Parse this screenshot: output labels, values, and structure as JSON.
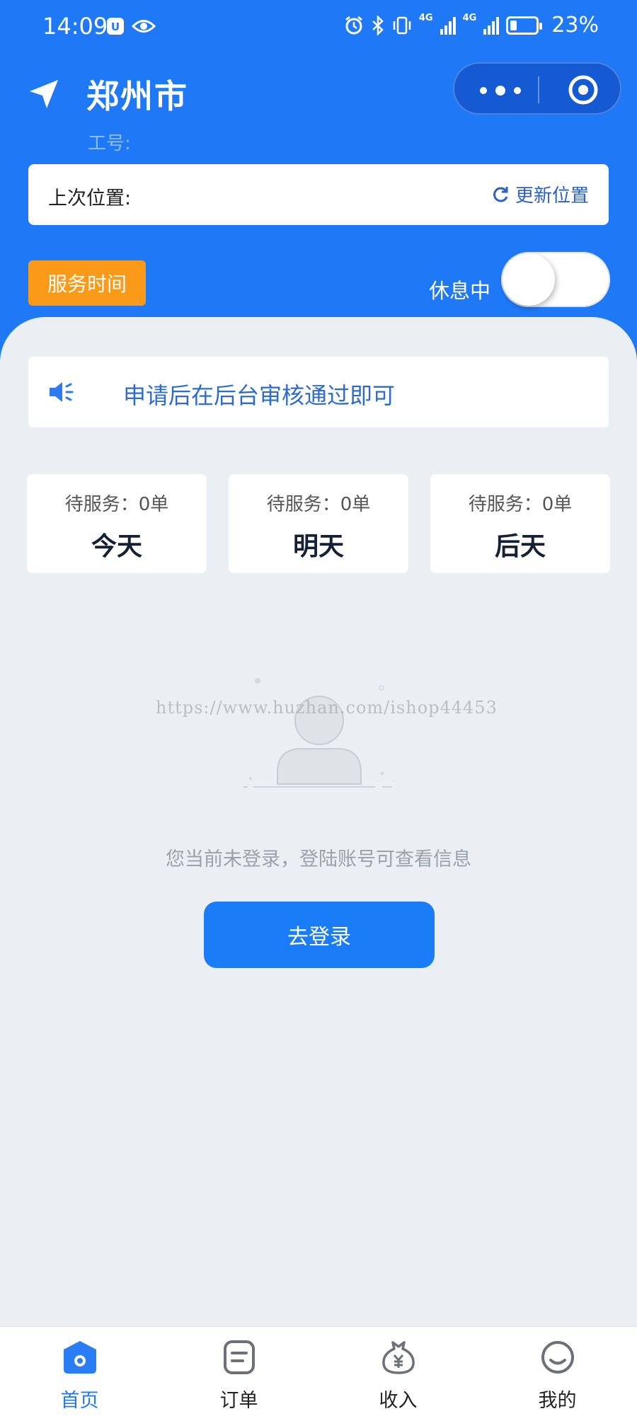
{
  "status_bar": {
    "time": "14:09",
    "network_1": "4G",
    "network_2": "4G",
    "battery": "23%",
    "battery_level": 0.23
  },
  "header": {
    "city": "郑州市",
    "worker_id_label": "工号:",
    "location_label": "上次位置:",
    "update_location": "更新位置",
    "service_time": "服务时间",
    "rest_status": "休息中",
    "rest_toggle_on": false
  },
  "notice": {
    "text": "申请后在后台审核通过即可",
    "icon": "speaker-icon"
  },
  "days": [
    {
      "pending": "待服务：0单",
      "day": "今天"
    },
    {
      "pending": "待服务：0单",
      "day": "明天"
    },
    {
      "pending": "待服务：0单",
      "day": "后天"
    }
  ],
  "empty": {
    "watermark": "https://www.huzhan.com/ishop44453",
    "message": "您当前未登录，登陆账号可查看信息",
    "login_button": "去登录"
  },
  "tabbar": [
    {
      "label": "首页",
      "icon": "home-icon",
      "active": true
    },
    {
      "label": "订单",
      "icon": "order-icon",
      "active": false
    },
    {
      "label": "收入",
      "icon": "income-icon",
      "active": false
    },
    {
      "label": "我的",
      "icon": "profile-icon",
      "active": false
    }
  ],
  "colors": {
    "primary": "#1f78f5",
    "accent_orange": "#fa9a18",
    "background": "#ebeff4",
    "notice_text": "#2e6bd0"
  }
}
